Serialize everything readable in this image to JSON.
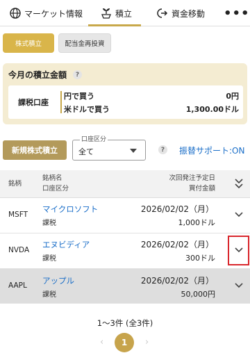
{
  "nav": {
    "market_label": "マーケット情報",
    "tsumitate_label": "積立",
    "transfer_label": "資金移動",
    "more_label": "•••"
  },
  "tabs": [
    {
      "label": "株式積立",
      "active": true
    },
    {
      "label": "配当金再投資",
      "active": false
    }
  ],
  "monthly": {
    "title": "今月の積立金額",
    "help": "?",
    "account_label": "課税口座",
    "rows": [
      {
        "label": "円で買う",
        "value": "0円"
      },
      {
        "label": "米ドルで買う",
        "value": "1,300.00ドル"
      }
    ]
  },
  "actions": {
    "new_button": "新規株式積立",
    "account_select_legend": "口座区分",
    "account_select_value": "全て",
    "help": "?",
    "transfer_support": "振替サポート:ON"
  },
  "table": {
    "headers": {
      "ticker": "銘柄",
      "name": "銘柄名",
      "account": "口座区分",
      "next_date": "次回発注予定日",
      "amount": "買付金額"
    },
    "rows": [
      {
        "ticker": "MSFT",
        "name": "マイクロソフト",
        "account": "課税",
        "date": "2026/02/02（月）",
        "amount": "1,000ドル"
      },
      {
        "ticker": "NVDA",
        "name": "エヌビディア",
        "account": "課税",
        "date": "2026/02/02（月）",
        "amount": "300ドル"
      },
      {
        "ticker": "AAPL",
        "name": "アップル",
        "account": "課税",
        "date": "2026/02/02（月）",
        "amount": "50,000円"
      }
    ]
  },
  "pager": {
    "info": "1〜3件 (全3件)",
    "prev": "‹",
    "current": "1",
    "next": "›"
  },
  "colors": {
    "accent_gold": "#d9b54a",
    "button_gold": "#b39a5b",
    "link_blue": "#1a6ec8",
    "highlight_red": "#d9262c",
    "panel_beige": "#f4ecd2"
  }
}
